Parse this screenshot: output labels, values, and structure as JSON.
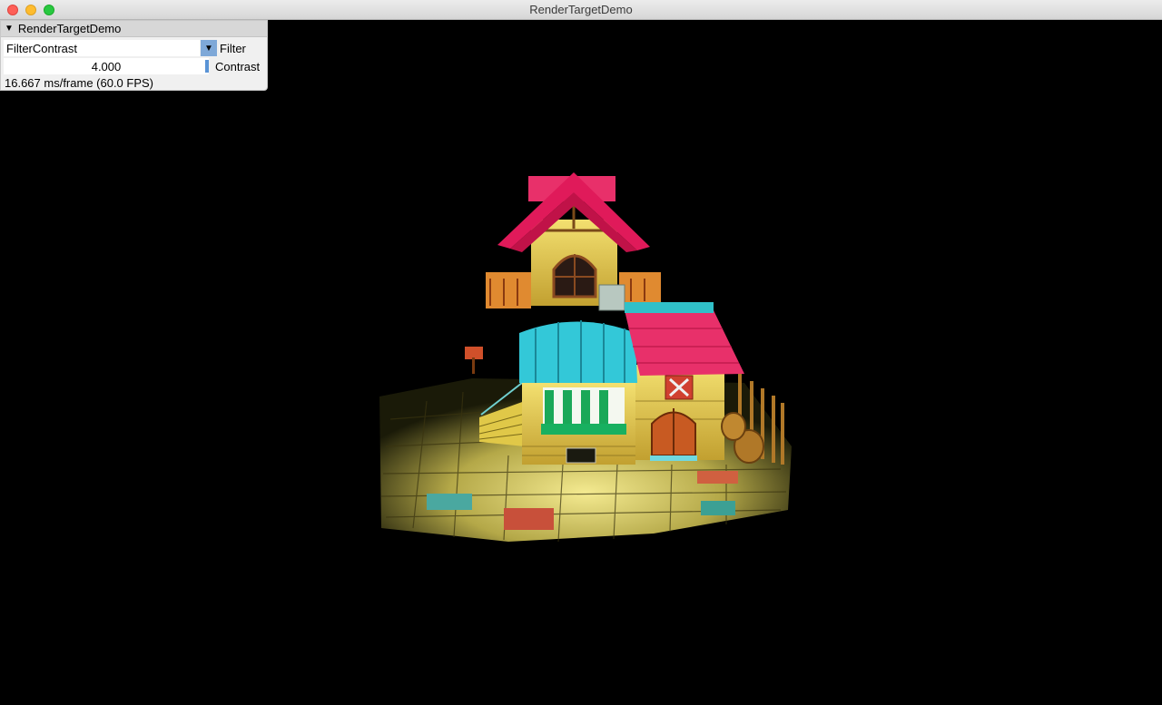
{
  "window": {
    "title": "RenderTargetDemo"
  },
  "panel": {
    "title": "RenderTargetDemo",
    "filter_value": "FilterContrast",
    "filter_label": "Filter",
    "contrast_value": "4.000",
    "contrast_label": "Contrast",
    "contrast_level": 1.0,
    "stats": "16.667 ms/frame (60.0 FPS)"
  },
  "icons": {
    "close": "close-icon",
    "minimize": "minimize-icon",
    "maximize": "maximize-icon",
    "collapse": "collapse-triangle-icon",
    "dropdown": "dropdown-arrow-icon"
  },
  "colors": {
    "roof_red": "#e01a5a",
    "awning_cyan": "#33c8d8",
    "wall_yellow": "#e8d050",
    "slider_accent": "#5a94d6"
  }
}
